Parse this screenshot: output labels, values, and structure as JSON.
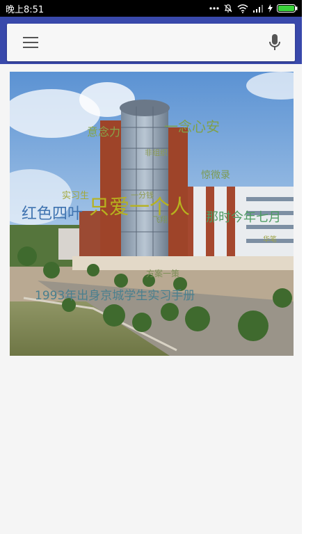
{
  "status_bar": {
    "time": "晚上8:51"
  },
  "toolbar": {
    "menu_icon": "hamburger-menu-icon",
    "mic_icon": "microphone-icon",
    "background_color": "#3949ab"
  },
  "word_cloud": {
    "words": [
      {
        "text": "意念力",
        "color": "#86a54a"
      },
      {
        "text": "一念心安",
        "color": "#7fa04b"
      },
      {
        "text": "非组织",
        "color": "#8b9b56"
      },
      {
        "text": "惊微录",
        "color": "#7c9a52"
      },
      {
        "text": "实习生",
        "color": "#a3a83a"
      },
      {
        "text": "红色四叶",
        "color": "#3f73b0"
      },
      {
        "text": "只爱一个人",
        "color": "#b7b21e"
      },
      {
        "text": "那时今年七月",
        "color": "#4f9c63"
      },
      {
        "text": "一分钱",
        "color": "#8e9a4f"
      },
      {
        "text": "飞翔",
        "color": "#7e9658"
      },
      {
        "text": "华笔",
        "color": "#9fa54a"
      },
      {
        "text": "方案一策",
        "color": "#7d8f57"
      },
      {
        "text": "1993年出身京城学生实习手册",
        "color": "#4a7f8e"
      }
    ]
  }
}
